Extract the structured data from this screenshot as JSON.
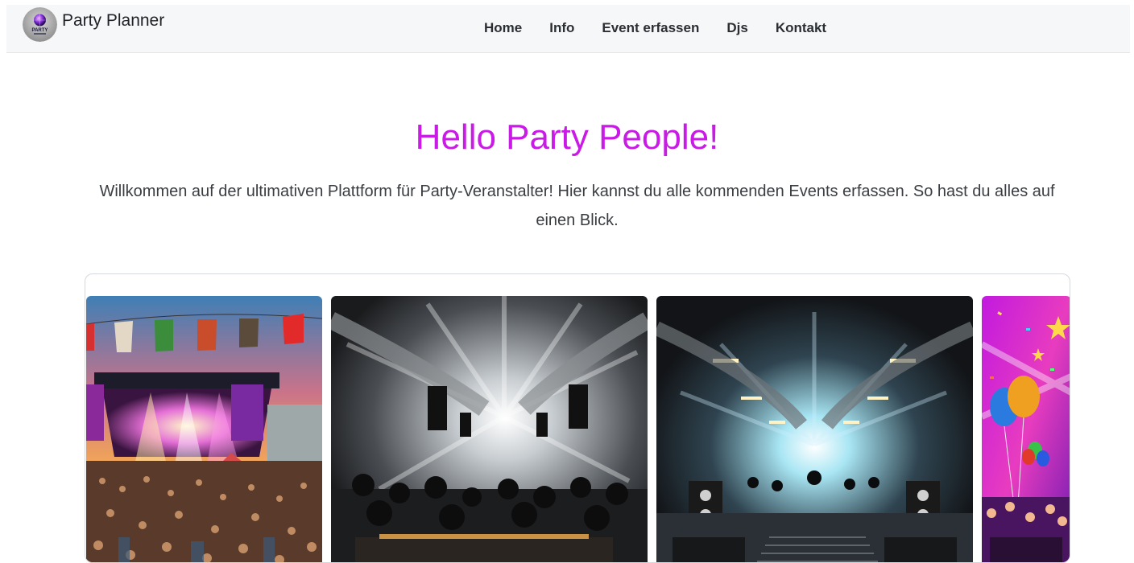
{
  "nav": {
    "brand": "Party Planner",
    "logo_text": "PARTY",
    "links": [
      {
        "label": "Home"
      },
      {
        "label": "Info"
      },
      {
        "label": "Event erfassen"
      },
      {
        "label": "Djs"
      },
      {
        "label": "Kontakt"
      }
    ]
  },
  "hero": {
    "title": "Hello Party People!",
    "text": "Willkommen auf der ultimativen Plattform für Party-Veranstalter! Hier kannst du alle kommenden Events erfassen. So hast du alles auf einen Blick."
  },
  "carousel": {
    "slides": [
      {
        "subject": "festival-stage-image"
      },
      {
        "subject": "underground-club-image"
      },
      {
        "subject": "warehouse-dj-image"
      },
      {
        "subject": "balloon-party-image"
      }
    ]
  },
  "colors": {
    "accent": "#c91ae6",
    "navbar_bg": "#f6f7f8",
    "text": "#3a3d42"
  }
}
